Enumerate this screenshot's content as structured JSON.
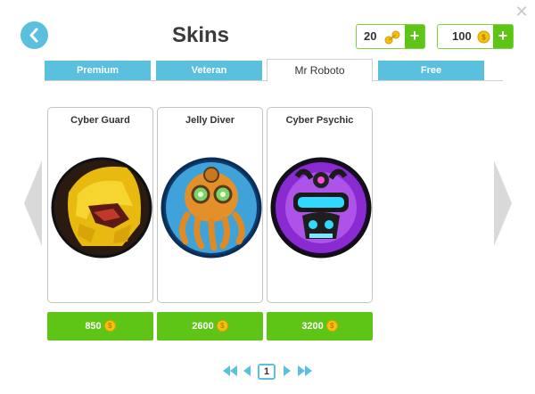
{
  "title": "Skins",
  "currencies": {
    "gears": {
      "amount": "20",
      "icon": "gear-currency-icon",
      "plus": "+"
    },
    "coins": {
      "amount": "100",
      "icon": "coin-icon",
      "plus": "+"
    }
  },
  "tabs": [
    {
      "label": "Premium",
      "active": false
    },
    {
      "label": "Veteran",
      "active": false
    },
    {
      "label": "Mr Roboto",
      "active": true
    },
    {
      "label": "Free",
      "active": false
    }
  ],
  "skins": [
    {
      "name": "Cyber Guard",
      "price": "850",
      "icon": "cyber-guard-portrait"
    },
    {
      "name": "Jelly Diver",
      "price": "2600",
      "icon": "jelly-diver-portrait"
    },
    {
      "name": "Cyber Psychic",
      "price": "3200",
      "icon": "cyber-psychic-portrait"
    }
  ],
  "pagination": {
    "current_page": "1"
  },
  "colors": {
    "accent_blue": "#5bc0de",
    "accent_green": "#5ec516",
    "gold": "#f4c20d"
  }
}
